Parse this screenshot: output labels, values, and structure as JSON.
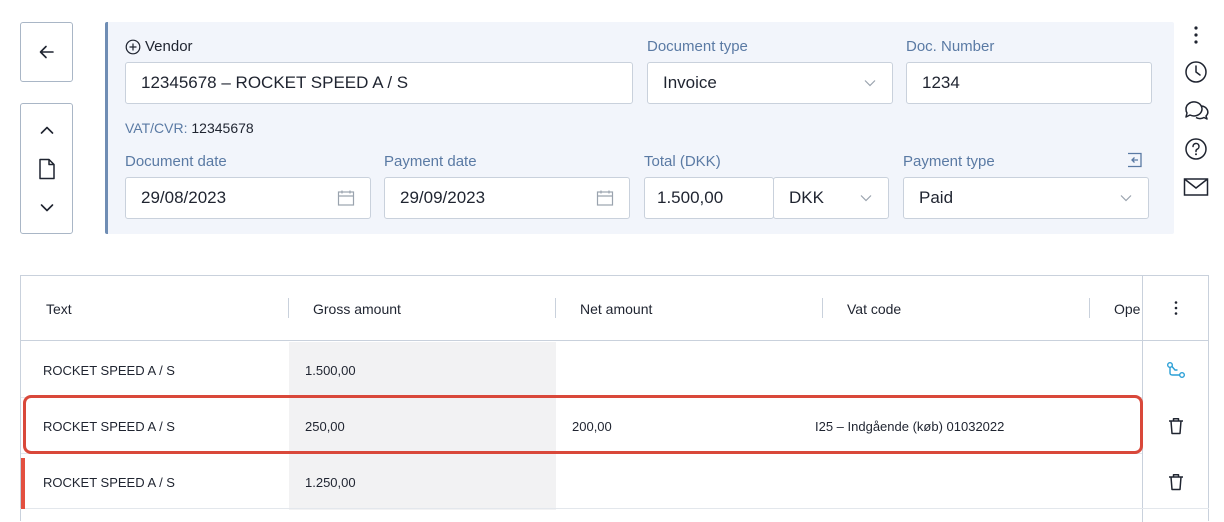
{
  "vendor": {
    "label": "Vendor",
    "value": "12345678 – ROCKET SPEED A / S"
  },
  "vat": {
    "label": "VAT/CVR:",
    "value": "12345678"
  },
  "document_type": {
    "label": "Document type",
    "value": "Invoice"
  },
  "doc_number": {
    "label": "Doc. Number",
    "value": "1234"
  },
  "document_date": {
    "label": "Document date",
    "value": "29/08/2023"
  },
  "payment_date": {
    "label": "Payment date",
    "value": "29/09/2023"
  },
  "total": {
    "label": "Total (DKK)",
    "value": "1.500,00",
    "currency": "DKK"
  },
  "payment_type": {
    "label": "Payment type",
    "value": "Paid"
  },
  "table": {
    "columns": [
      "Text",
      "Gross amount",
      "Net amount",
      "Vat code",
      "Ope"
    ],
    "rows": [
      {
        "text": "ROCKET SPEED A / S",
        "gross": "1.500,00",
        "net": "",
        "vat_code": ""
      },
      {
        "text": "ROCKET SPEED A / S",
        "gross": "250,00",
        "net": "200,00",
        "vat_code": "I25 – Indgående (køb) 01032022"
      },
      {
        "text": "ROCKET SPEED A / S",
        "gross": "1.250,00",
        "net": "",
        "vat_code": ""
      }
    ]
  },
  "colors": {
    "accent": "#5a7aa4",
    "panel_bg": "#f2f5fb",
    "error": "#e35040",
    "split_icon": "#2a9fd6"
  },
  "icons": {
    "back": "arrow-left-icon",
    "prev": "chevron-up-icon",
    "doc": "document-icon",
    "next": "chevron-down-icon",
    "more": "more-vertical-icon",
    "history": "clock-icon",
    "comments": "chat-icon",
    "help": "help-icon",
    "mail": "mail-icon",
    "collapse": "collapse-panel-icon",
    "split": "split-icon",
    "delete": "trash-icon"
  }
}
